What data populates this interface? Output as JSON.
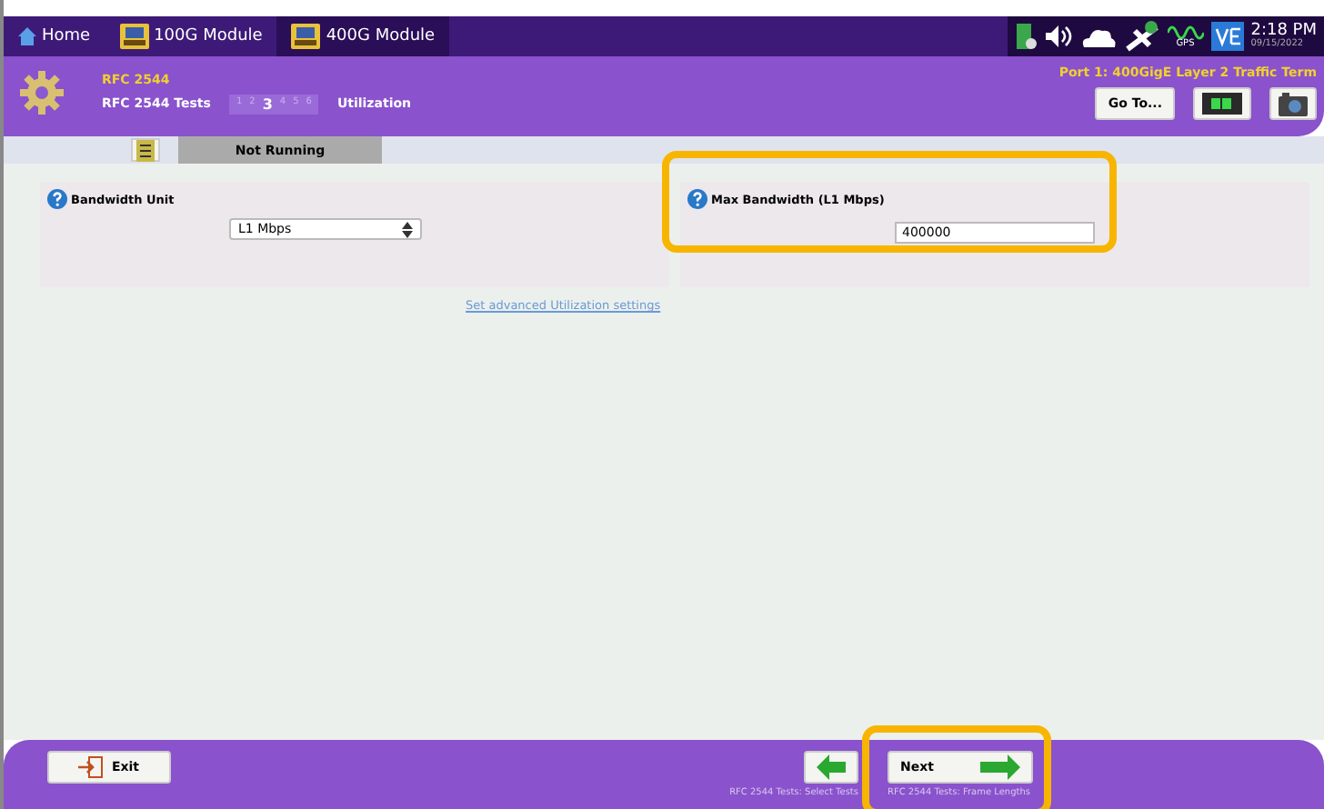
{
  "top_tabs": [
    {
      "label": "Home",
      "kind": "home",
      "selected": false
    },
    {
      "label": "100G Module",
      "kind": "module",
      "selected": false
    },
    {
      "label": "400G Module",
      "kind": "module",
      "selected": true
    }
  ],
  "status": {
    "time": "2:18 PM",
    "date": "09/15/2022",
    "gps": "GPS"
  },
  "header": {
    "app": "RFC 2544",
    "test": "RFC 2544 Tests",
    "steps": [
      {
        "label": "1",
        "selected": false
      },
      {
        "label": "2",
        "selected": false
      },
      {
        "label": "3",
        "selected": true
      },
      {
        "label": "4",
        "selected": false
      },
      {
        "label": "5",
        "selected": false
      },
      {
        "label": "6",
        "selected": false
      }
    ],
    "page": "Utilization",
    "port": "Port 1: 400GigE Layer 2 Traffic Term",
    "goto": "Go To..."
  },
  "run_state": "Not Running",
  "bandwidth_unit": {
    "label": "Bandwidth Unit",
    "value": "L1 Mbps"
  },
  "max_bandwidth": {
    "label": "Max Bandwidth (L1 Mbps)",
    "value": "400000"
  },
  "advanced_link": "Set advanced Utilization settings",
  "footer": {
    "exit": "Exit",
    "back_caption": "RFC 2544 Tests: Select Tests",
    "next": "Next",
    "next_caption": "RFC 2544 Tests: Frame Lengths"
  }
}
